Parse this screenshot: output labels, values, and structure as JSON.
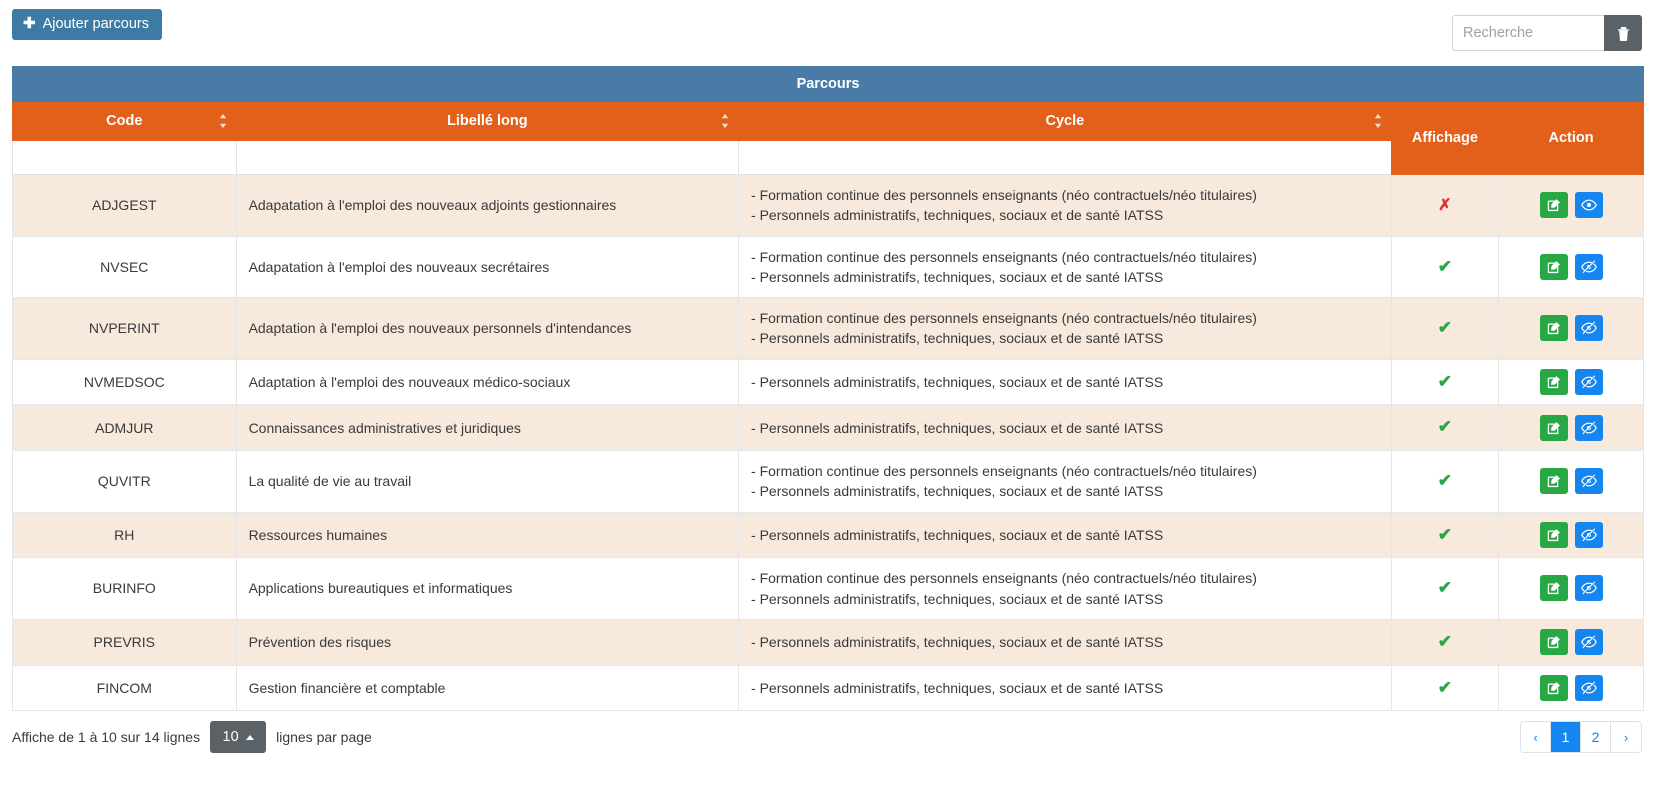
{
  "toolbar": {
    "add_label": "Ajouter parcours",
    "add_icon": "plus-icon",
    "search_placeholder": "Recherche",
    "search_value": "",
    "clear_icon": "trash-icon"
  },
  "table": {
    "title": "Parcours",
    "columns": [
      {
        "label": "Code",
        "sortable": true
      },
      {
        "label": "Libellé long",
        "sortable": true
      },
      {
        "label": "Cycle",
        "sortable": true
      },
      {
        "label": "Affichage",
        "sortable": false
      },
      {
        "label": "Action",
        "sortable": false
      }
    ],
    "filters": {
      "code": "",
      "libelle": "",
      "cycle": ""
    },
    "rows": [
      {
        "code": "ADJGEST",
        "libelle": "Adapatation à l'emploi des nouveaux adjoints gestionnaires",
        "cycles": [
          "- Formation continue des personnels enseignants (néo contractuels/néo titulaires)",
          "- Personnels administratifs, techniques, sociaux et de santé IATSS"
        ],
        "affichage": false,
        "affichage_mark": "✗",
        "view_icon": "eye-icon"
      },
      {
        "code": "NVSEC",
        "libelle": "Adapatation à l'emploi des nouveaux secrétaires",
        "cycles": [
          "- Formation continue des personnels enseignants (néo contractuels/néo titulaires)",
          "- Personnels administratifs, techniques, sociaux et de santé IATSS"
        ],
        "affichage": true,
        "affichage_mark": "✔",
        "view_icon": "eye-slash-icon"
      },
      {
        "code": "NVPERINT",
        "libelle": "Adaptation à l'emploi des nouveaux personnels d'intendances",
        "cycles": [
          "- Formation continue des personnels enseignants (néo contractuels/néo titulaires)",
          "- Personnels administratifs, techniques, sociaux et de santé IATSS"
        ],
        "affichage": true,
        "affichage_mark": "✔",
        "view_icon": "eye-slash-icon"
      },
      {
        "code": "NVMEDSOC",
        "libelle": "Adaptation à l'emploi des nouveaux médico-sociaux",
        "cycles": [
          "- Personnels administratifs, techniques, sociaux et de santé IATSS"
        ],
        "affichage": true,
        "affichage_mark": "✔",
        "view_icon": "eye-slash-icon"
      },
      {
        "code": "ADMJUR",
        "libelle": "Connaissances administratives et juridiques",
        "cycles": [
          "- Personnels administratifs, techniques, sociaux et de santé IATSS"
        ],
        "affichage": true,
        "affichage_mark": "✔",
        "view_icon": "eye-slash-icon"
      },
      {
        "code": "QUVITR",
        "libelle": "La qualité de vie au travail",
        "cycles": [
          "- Formation continue des personnels enseignants (néo contractuels/néo titulaires)",
          "- Personnels administratifs, techniques, sociaux et de santé IATSS"
        ],
        "affichage": true,
        "affichage_mark": "✔",
        "view_icon": "eye-slash-icon"
      },
      {
        "code": "RH",
        "libelle": "Ressources humaines",
        "cycles": [
          "- Personnels administratifs, techniques, sociaux et de santé IATSS"
        ],
        "affichage": true,
        "affichage_mark": "✔",
        "view_icon": "eye-slash-icon"
      },
      {
        "code": "BURINFO",
        "libelle": "Applications bureautiques et informatiques",
        "cycles": [
          "- Formation continue des personnels enseignants (néo contractuels/néo titulaires)",
          "- Personnels administratifs, techniques, sociaux et de santé IATSS"
        ],
        "affichage": true,
        "affichage_mark": "✔",
        "view_icon": "eye-slash-icon"
      },
      {
        "code": "PREVRIS",
        "libelle": "Prévention des risques",
        "cycles": [
          "- Personnels administratifs, techniques, sociaux et de santé IATSS"
        ],
        "affichage": true,
        "affichage_mark": "✔",
        "view_icon": "eye-slash-icon"
      },
      {
        "code": "FINCOM",
        "libelle": "Gestion financière et comptable",
        "cycles": [
          "- Personnels administratifs, techniques, sociaux et de santé IATSS"
        ],
        "affichage": true,
        "affichage_mark": "✔",
        "view_icon": "eye-slash-icon"
      }
    ]
  },
  "footer": {
    "info": "Affiche de 1 à 10 sur 14 lignes",
    "page_size": "10",
    "page_size_suffix": "lignes par page",
    "pagination": {
      "prev": "‹",
      "next": "›",
      "pages": [
        "1",
        "2"
      ],
      "active": "1"
    }
  },
  "colors": {
    "title_band": "#4a7ba7",
    "header": "#e2601a",
    "primary": "#3d7ba5",
    "edit": "#28a745",
    "view": "#1586f0",
    "yes": "#28a745",
    "no": "#e03131",
    "row_odd": "#f7e9db"
  }
}
